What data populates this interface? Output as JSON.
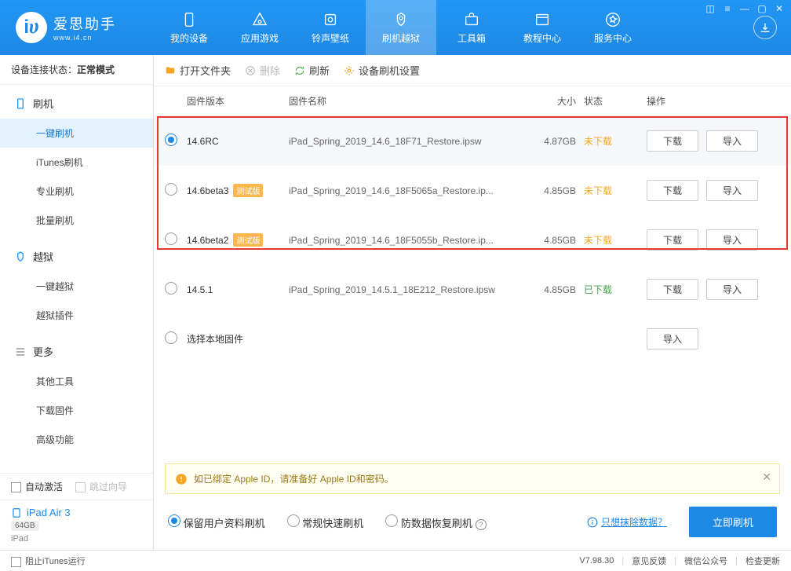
{
  "logo": {
    "title": "爱思助手",
    "url": "www.i4.cn"
  },
  "nav": [
    {
      "label": "我的设备"
    },
    {
      "label": "应用游戏"
    },
    {
      "label": "铃声壁纸"
    },
    {
      "label": "刷机越狱"
    },
    {
      "label": "工具箱"
    },
    {
      "label": "教程中心"
    },
    {
      "label": "服务中心"
    }
  ],
  "sidebar": {
    "status_prefix": "设备连接状态：",
    "status_value": "正常模式",
    "groups": [
      {
        "title": "刷机",
        "items": [
          "一键刷机",
          "iTunes刷机",
          "专业刷机",
          "批量刷机"
        ]
      },
      {
        "title": "越狱",
        "items": [
          "一键越狱",
          "越狱插件"
        ]
      },
      {
        "title": "更多",
        "items": [
          "其他工具",
          "下载固件",
          "高级功能"
        ]
      }
    ],
    "auto_activate": "自动激活",
    "skip_guide": "跳过向导",
    "device_name": "iPad Air 3",
    "device_storage": "64GB",
    "device_type": "iPad"
  },
  "toolbar": {
    "open": "打开文件夹",
    "delete": "删除",
    "refresh": "刷新",
    "settings": "设备刷机设置"
  },
  "table": {
    "head": {
      "version": "固件版本",
      "name": "固件名称",
      "size": "大小",
      "status": "状态",
      "ops": "操作"
    },
    "rows": [
      {
        "version": "14.6RC",
        "test": false,
        "name": "iPad_Spring_2019_14.6_18F71_Restore.ipsw",
        "size": "4.87GB",
        "status": "未下载",
        "status_class": "status-undl",
        "selected": true,
        "download": true
      },
      {
        "version": "14.6beta3",
        "test": true,
        "name": "iPad_Spring_2019_14.6_18F5065a_Restore.ip...",
        "size": "4.85GB",
        "status": "未下载",
        "status_class": "status-undl",
        "selected": false,
        "download": true
      },
      {
        "version": "14.6beta2",
        "test": true,
        "name": "iPad_Spring_2019_14.6_18F5055b_Restore.ip...",
        "size": "4.85GB",
        "status": "未下载",
        "status_class": "status-undl",
        "selected": false,
        "download": true
      },
      {
        "version": "14.5.1",
        "test": false,
        "name": "iPad_Spring_2019_14.5.1_18E212_Restore.ipsw",
        "size": "4.85GB",
        "status": "已下载",
        "status_class": "status-dl",
        "selected": false,
        "download": true
      },
      {
        "version": "选择本地固件",
        "test": false,
        "name": "",
        "size": "",
        "status": "",
        "status_class": "",
        "selected": false,
        "download": false
      }
    ],
    "test_badge": "测试版",
    "download_btn": "下载",
    "import_btn": "导入"
  },
  "notice": "如已绑定 Apple ID，请准备好 Apple ID和密码。",
  "options": {
    "opt1": "保留用户资料刷机",
    "opt2": "常规快速刷机",
    "opt3": "防数据恢复刷机",
    "erase_link": "只想抹除数据？",
    "flash_btn": "立即刷机"
  },
  "statusbar": {
    "block_itunes": "阻止iTunes运行",
    "version": "V7.98.30",
    "feedback": "意见反馈",
    "wechat": "微信公众号",
    "check_update": "检查更新"
  }
}
